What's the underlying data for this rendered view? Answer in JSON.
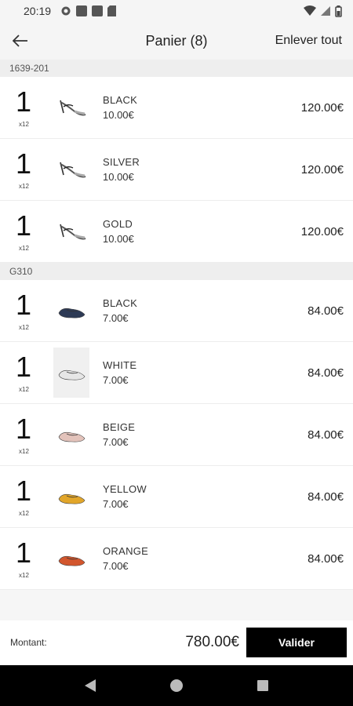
{
  "status": {
    "time": "20:19"
  },
  "header": {
    "title": "Panier (8)",
    "clear_all": "Enlever tout"
  },
  "groups": [
    {
      "label": "1639-201",
      "items": [
        {
          "qty": "1",
          "mult": "x12",
          "color": "BLACK",
          "unit_price": "10.00€",
          "total": "120.00€",
          "image": "heel-sandal-icon"
        },
        {
          "qty": "1",
          "mult": "x12",
          "color": "SILVER",
          "unit_price": "10.00€",
          "total": "120.00€",
          "image": "heel-sandal-icon"
        },
        {
          "qty": "1",
          "mult": "x12",
          "color": "GOLD",
          "unit_price": "10.00€",
          "total": "120.00€",
          "image": "heel-sandal-icon"
        }
      ]
    },
    {
      "label": "G310",
      "items": [
        {
          "qty": "1",
          "mult": "x12",
          "color": "BLACK",
          "unit_price": "7.00€",
          "total": "84.00€",
          "image": "loafer-icon"
        },
        {
          "qty": "1",
          "mult": "x12",
          "color": "WHITE",
          "unit_price": "7.00€",
          "total": "84.00€",
          "image": "loafer-icon"
        },
        {
          "qty": "1",
          "mult": "x12",
          "color": "BEIGE",
          "unit_price": "7.00€",
          "total": "84.00€",
          "image": "loafer-icon"
        },
        {
          "qty": "1",
          "mult": "x12",
          "color": "YELLOW",
          "unit_price": "7.00€",
          "total": "84.00€",
          "image": "loafer-icon"
        },
        {
          "qty": "1",
          "mult": "x12",
          "color": "ORANGE",
          "unit_price": "7.00€",
          "total": "84.00€",
          "image": "loafer-icon"
        }
      ]
    }
  ],
  "footer": {
    "label": "Montant:",
    "amount": "780.00€",
    "validate": "Valider"
  },
  "colors": {
    "accent": "#000000",
    "shoe_black": "#2d3a55",
    "shoe_white": "#e6e6e6",
    "shoe_beige": "#e3c3bb",
    "shoe_yellow": "#e2a62a",
    "shoe_orange": "#d2562d"
  }
}
